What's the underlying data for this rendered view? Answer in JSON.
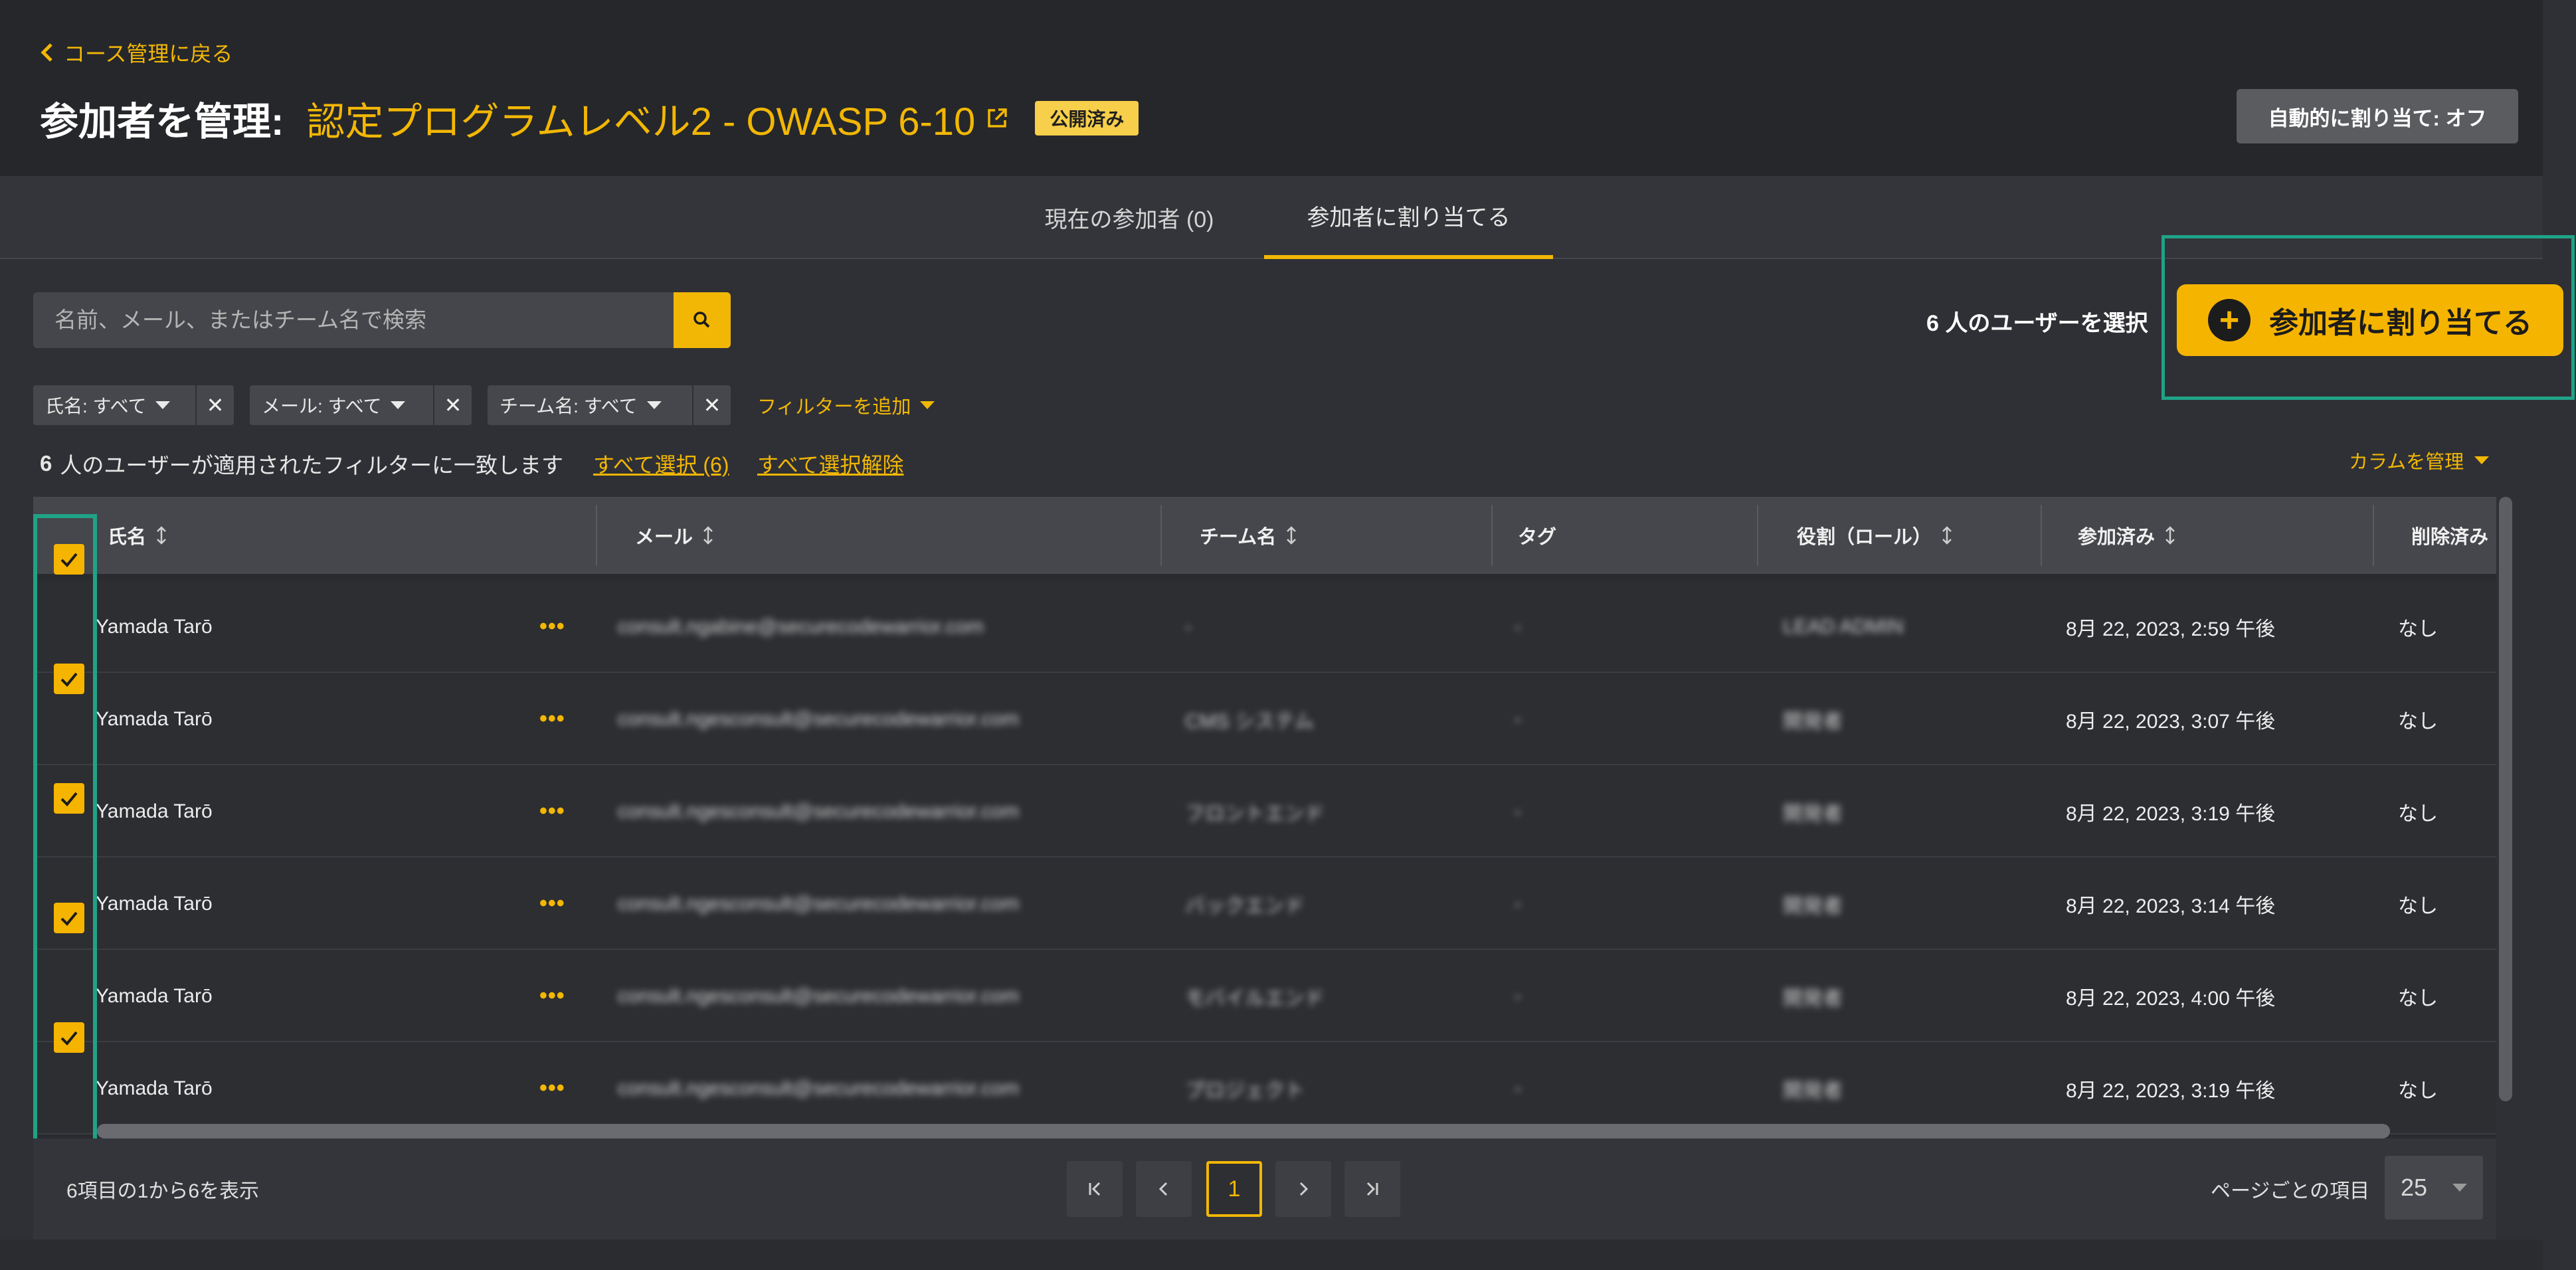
{
  "header": {
    "back_label": "コース管理に戻る",
    "title_label": "参加者を管理:",
    "course_name": "認定プログラムレベル2 - OWASP 6-10",
    "status_badge": "公開済み",
    "auto_assign_label": "自動的に割り当て: オフ"
  },
  "tabs": [
    {
      "label": "現在の参加者 (0)",
      "active": false
    },
    {
      "label": "参加者に割り当てる",
      "active": true
    }
  ],
  "search": {
    "placeholder": "名前、メール、またはチーム名で検索",
    "value": ""
  },
  "selection": {
    "count_label": "6 人のユーザーを選択",
    "assign_button_label": "参加者に割り当てる"
  },
  "filters": [
    {
      "label": "氏名: すべて"
    },
    {
      "label": "メール: すべて"
    },
    {
      "label": "チーム名: すべて"
    }
  ],
  "add_filter_label": "フィルターを追加",
  "match": {
    "count": "6",
    "text": "人のユーザーが適用されたフィルターに一致します"
  },
  "select_all_label": "すべて選択 (6)",
  "deselect_all_label": "すべて選択解除",
  "manage_columns_label": "カラムを管理",
  "table": {
    "columns": [
      "氏名",
      "メール",
      "チーム名",
      "タグ",
      "役割（ロール）",
      "参加済み",
      "削除済み"
    ],
    "rows": [
      {
        "name": "Yamada Tarō",
        "email": "consult.ngabine@securecodewarrior.com",
        "team": "-",
        "tag": "-",
        "role": "LEAD ADMIN",
        "joined": "8月 22, 2023, 2:59 午後",
        "deleted": "なし"
      },
      {
        "name": "Yamada Tarō",
        "email": "consult.ngesconsult@securecodewarrior.com",
        "team": "CMS システム",
        "tag": "-",
        "role": "開発者",
        "joined": "8月 22, 2023, 3:07 午後",
        "deleted": "なし"
      },
      {
        "name": "Yamada Tarō",
        "email": "consult.ngesconsult@securecodewarrior.com",
        "team": "フロントエンド",
        "tag": "-",
        "role": "開発者",
        "joined": "8月 22, 2023, 3:19 午後",
        "deleted": "なし"
      },
      {
        "name": "Yamada Tarō",
        "email": "consult.ngesconsult@securecodewarrior.com",
        "team": "バックエンド",
        "tag": "-",
        "role": "開発者",
        "joined": "8月 22, 2023, 3:14 午後",
        "deleted": "なし"
      },
      {
        "name": "Yamada Tarō",
        "email": "consult.ngesconsult@securecodewarrior.com",
        "team": "モバイルエンド",
        "tag": "-",
        "role": "開発者",
        "joined": "8月 22, 2023, 4:00 午後",
        "deleted": "なし"
      },
      {
        "name": "Yamada Tarō",
        "email": "consult.ngesconsult@securecodewarrior.com",
        "team": "プロジェクト",
        "tag": "-",
        "role": "開発者",
        "joined": "8月 22, 2023, 3:19 午後",
        "deleted": "なし"
      }
    ]
  },
  "pagination": {
    "range_text": "6項目の1から6を表示",
    "current_page": "1",
    "per_page_label": "ページごとの項目",
    "per_page_value": "25"
  },
  "colors": {
    "accent": "#f2b705",
    "highlight": "#1fa387",
    "background": "#2f3035"
  },
  "icons": [
    "chevron-left-icon",
    "external-link-icon",
    "search-icon",
    "plus-circle-icon",
    "caret-down-icon",
    "close-icon",
    "sort-icon",
    "more-dots-icon",
    "checkbox-checked-icon",
    "first-page-icon",
    "prev-page-icon",
    "next-page-icon",
    "last-page-icon"
  ]
}
